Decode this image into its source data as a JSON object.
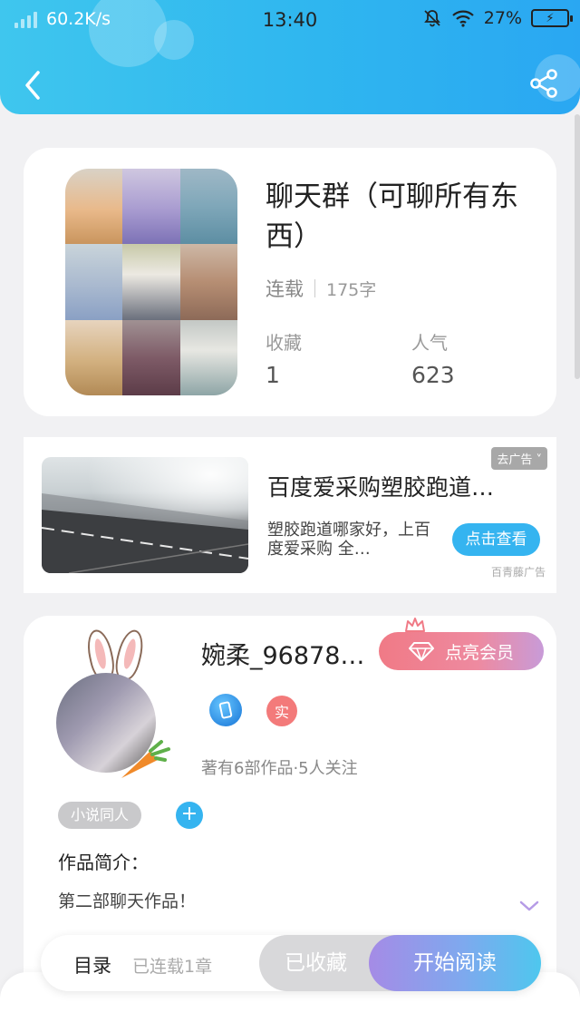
{
  "status_bar": {
    "net_speed": "60.2K/s",
    "time": "13:40",
    "battery": "27%"
  },
  "header": {
    "back_icon": "chevron-left-icon",
    "share_icon": "share-icon"
  },
  "book": {
    "title": "聊天群（可聊所有东西）",
    "status": "连载",
    "word_count": "175字",
    "favorites_label": "收藏",
    "favorites_value": "1",
    "popularity_label": "人气",
    "popularity_value": "623"
  },
  "ad": {
    "title": "百度爱采购塑胶跑道…",
    "desc": "塑胶跑道哪家好，上百度爱采购 全…",
    "go_label": "去广告",
    "button_label": "点击查看",
    "source": "百青藤广告"
  },
  "author": {
    "name": "婉柔_96878…",
    "vip_button": "点亮会员",
    "real_badge": "实",
    "stats": "著有6部作品·5人关注",
    "tag": "小说同人",
    "add_tag": "+",
    "intro_label": "作品简介：",
    "intro_text": "第二部聊天作品！"
  },
  "bottom_bar": {
    "toc_label": "目录",
    "serial_info": "已连载1章",
    "collect_button": "已收藏",
    "read_button": "开始阅读"
  },
  "colors": {
    "header_blue": "#2fb6ef",
    "accent_blue": "#35b4f0",
    "vip_pink": "#f07a86",
    "real_badge_red": "#f37a7a"
  }
}
